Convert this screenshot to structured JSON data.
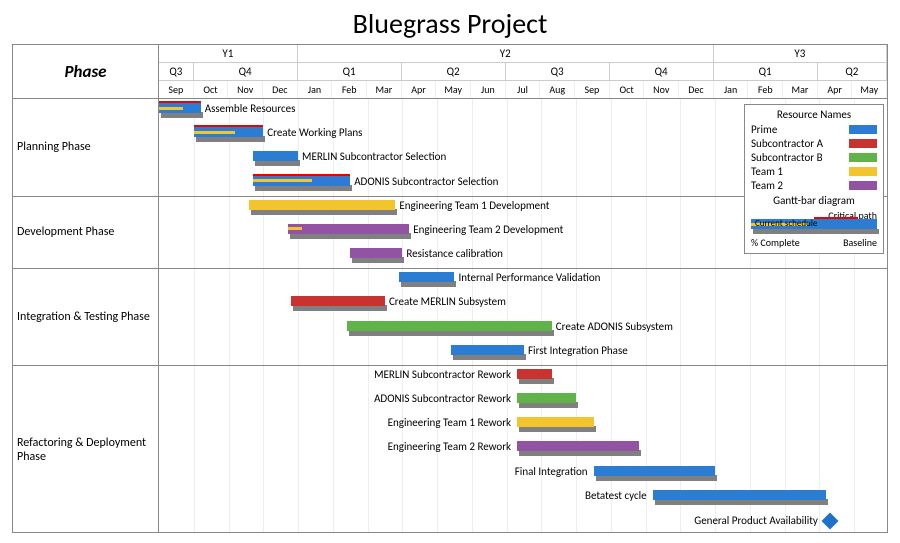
{
  "title": "Bluegrass Project",
  "phase_header": "Phase",
  "timeline": {
    "months": [
      "Sep",
      "Oct",
      "Nov",
      "Dec",
      "Jan",
      "Feb",
      "Mar",
      "Apr",
      "May",
      "Jun",
      "Jul",
      "Aug",
      "Sep",
      "Oct",
      "Nov",
      "Dec",
      "Jan",
      "Feb",
      "Mar",
      "Apr",
      "May"
    ],
    "quarters": [
      {
        "label": "Q3",
        "span": 1
      },
      {
        "label": "Q4",
        "span": 3
      },
      {
        "label": "Q1",
        "span": 3
      },
      {
        "label": "Q2",
        "span": 3
      },
      {
        "label": "Q3",
        "span": 3
      },
      {
        "label": "Q4",
        "span": 3
      },
      {
        "label": "Q1",
        "span": 3
      },
      {
        "label": "Q2",
        "span": 2
      }
    ],
    "years": [
      {
        "label": "Y1",
        "span": 4
      },
      {
        "label": "Y2",
        "span": 12
      },
      {
        "label": "Y3",
        "span": 5
      }
    ]
  },
  "phases": [
    {
      "name": "Planning Phase",
      "rows": 4
    },
    {
      "name": "Development Phase",
      "rows": 3
    },
    {
      "name": "Integration & Testing Phase",
      "rows": 4
    },
    {
      "name": "Refactoring & Deployment Phase",
      "rows": 7
    }
  ],
  "resources": {
    "Prime": "#2b7cd3",
    "SubcontractorA": "#c8322f",
    "SubcontractorB": "#5fb349",
    "Team1": "#f2c52f",
    "Team2": "#9253a3"
  },
  "legend": {
    "title": "Resource Names",
    "items": [
      {
        "label": "Prime",
        "color": "#2b7cd3"
      },
      {
        "label": "Subcontractor A",
        "color": "#c8322f"
      },
      {
        "label": "Subcontractor B",
        "color": "#5fb349"
      },
      {
        "label": "Team 1",
        "color": "#f2c52f"
      },
      {
        "label": "Team 2",
        "color": "#9253a3"
      }
    ],
    "gantt_title": "Gantt-bar diagram",
    "critical_label": "Critical path",
    "current_label": "Current schedule",
    "complete_label": "% Complete",
    "baseline_label": "Baseline"
  },
  "chart_data": {
    "type": "gantt",
    "unit": "month_index_0_is_Sep_Y1",
    "tasks": [
      {
        "phase": 0,
        "row": 0,
        "label": "Assemble Resources",
        "start": 0,
        "end": 1.2,
        "color": "Prime",
        "baseline_start": 0,
        "baseline_end": 1.2,
        "progress_color": "Team1",
        "progress_end": 0.7,
        "critical": true
      },
      {
        "phase": 0,
        "row": 1,
        "label": "Create Working Plans",
        "start": 1,
        "end": 3,
        "color": "Prime",
        "baseline_start": 1,
        "baseline_end": 3,
        "progress_color": "Team1",
        "progress_end": 2.2,
        "critical": true
      },
      {
        "phase": 0,
        "row": 2,
        "label": "MERLIN Subcontractor Selection",
        "start": 2.7,
        "end": 4,
        "color": "Prime",
        "baseline_start": 2.7,
        "baseline_end": 4,
        "critical": false
      },
      {
        "phase": 0,
        "row": 3,
        "label": "ADONIS Subcontractor Selection",
        "start": 2.7,
        "end": 5.5,
        "color": "Prime",
        "baseline_start": 2.7,
        "baseline_end": 5.5,
        "progress_color": "Team1",
        "progress_end": 4.4,
        "critical": true
      },
      {
        "phase": 1,
        "row": 0,
        "label": "Engineering Team 1 Development",
        "start": 2.6,
        "end": 6.8,
        "color": "Team1",
        "baseline_start": 2.6,
        "baseline_end": 6.8,
        "critical": false
      },
      {
        "phase": 1,
        "row": 1,
        "label": "Engineering Team 2 Development",
        "start": 3.7,
        "end": 7.2,
        "color": "Team2",
        "baseline_start": 3.7,
        "baseline_end": 7.2,
        "progress_color": "Team1",
        "progress_end": 4.1,
        "critical": false
      },
      {
        "phase": 1,
        "row": 2,
        "label": "Resistance calibration",
        "start": 5.5,
        "end": 7,
        "color": "Team2",
        "baseline_start": 5.5,
        "baseline_end": 7,
        "critical": false
      },
      {
        "phase": 2,
        "row": 0,
        "label": "Internal Performance Validation",
        "start": 6.9,
        "end": 8.5,
        "color": "Prime",
        "baseline_start": 6.9,
        "baseline_end": 8.5,
        "critical": false
      },
      {
        "phase": 2,
        "row": 1,
        "label": "Create MERLIN Subsystem",
        "start": 3.8,
        "end": 6.5,
        "color": "SubcontractorA",
        "baseline_start": 3.8,
        "baseline_end": 6.5,
        "critical": false
      },
      {
        "phase": 2,
        "row": 2,
        "label": "Create ADONIS Subsystem",
        "start": 5.4,
        "end": 11.3,
        "color": "SubcontractorB",
        "baseline_start": 5.4,
        "baseline_end": 11.3,
        "critical": false
      },
      {
        "phase": 2,
        "row": 3,
        "label": "First Integration Phase",
        "start": 8.4,
        "end": 10.5,
        "color": "Prime",
        "baseline_start": 8.4,
        "baseline_end": 10.5,
        "critical": false
      },
      {
        "phase": 3,
        "row": 0,
        "label": "MERLIN Subcontractor Rework",
        "start": 10.3,
        "end": 11.3,
        "color": "SubcontractorA",
        "baseline_start": 10.3,
        "baseline_end": 11.3,
        "critical": false,
        "label_side": "left"
      },
      {
        "phase": 3,
        "row": 1,
        "label": "ADONIS Subcontractor Rework",
        "start": 10.3,
        "end": 12,
        "color": "SubcontractorB",
        "baseline_start": 10.3,
        "baseline_end": 12,
        "critical": false,
        "label_side": "left"
      },
      {
        "phase": 3,
        "row": 2,
        "label": "Engineering Team 1 Rework",
        "start": 10.3,
        "end": 12.5,
        "color": "Team1",
        "baseline_start": 10.3,
        "baseline_end": 12.5,
        "critical": false,
        "label_side": "left"
      },
      {
        "phase": 3,
        "row": 3,
        "label": "Engineering Team 2 Rework",
        "start": 10.3,
        "end": 13.8,
        "color": "Team2",
        "baseline_start": 10.3,
        "baseline_end": 13.8,
        "critical": false,
        "label_side": "left"
      },
      {
        "phase": 3,
        "row": 4,
        "label": "Final Integration",
        "start": 12.5,
        "end": 16,
        "color": "Prime",
        "baseline_start": 12.5,
        "baseline_end": 16,
        "critical": false,
        "label_side": "left"
      },
      {
        "phase": 3,
        "row": 5,
        "label": "Betatest cycle",
        "start": 14.2,
        "end": 19.2,
        "color": "Prime",
        "baseline_start": 14.2,
        "baseline_end": 19.2,
        "critical": false,
        "label_side": "left"
      },
      {
        "phase": 3,
        "row": 6,
        "label": "General Product Availability",
        "milestone": true,
        "start": 19.3,
        "label_side": "left"
      }
    ]
  }
}
